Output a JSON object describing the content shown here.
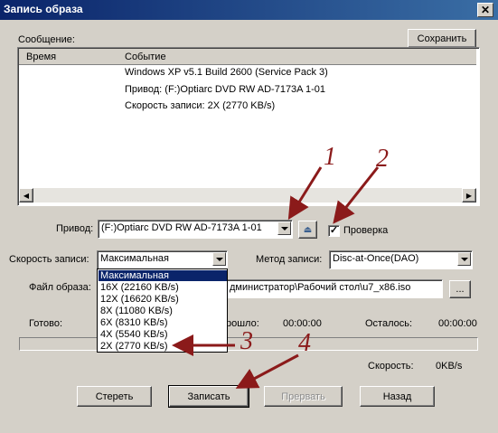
{
  "window": {
    "title": "Запись образа",
    "close_glyph": "✕"
  },
  "message": {
    "label": "Сообщение:",
    "save_button": "Сохранить"
  },
  "log": {
    "col_time": "Время",
    "col_event": "Событие",
    "rows": [
      {
        "event": "Windows XP v5.1 Build 2600 (Service Pack 3)"
      },
      {
        "event": "Привод: (F:)Optiarc DVD RW AD-7173A 1-01"
      },
      {
        "event": "Скорость записи: 2X (2770 KB/s)"
      }
    ]
  },
  "drive": {
    "label": "Привод:",
    "value": "(F:)Optiarc DVD RW AD-7173A 1-01"
  },
  "verify": {
    "label": "Проверка",
    "checked": true
  },
  "speed": {
    "label": "Скорость записи:",
    "value": "Максимальная",
    "options": [
      "Максимальная",
      "16X (22160 KB/s)",
      "12X (16620 KB/s)",
      "8X (11080 KB/s)",
      "6X (8310 KB/s)",
      "4X (5540 KB/s)",
      "2X (2770 KB/s)"
    ]
  },
  "method": {
    "label": "Метод записи:",
    "value": "Disc-at-Once(DAO)"
  },
  "image_file": {
    "label": "Файл образа:",
    "value": "дминистратор\\Рабочий стол\\u7_x86.iso",
    "browse": "..."
  },
  "status": {
    "ready_label": "Готово:",
    "elapsed_label": "рошло:",
    "elapsed_value": "00:00:00",
    "remaining_label": "Осталось:",
    "remaining_value": "00:00:00",
    "progress": 0,
    "speed_label": "Скорость:",
    "speed_value": "0KB/s"
  },
  "buttons": {
    "erase": "Стереть",
    "write": "Записать",
    "abort": "Прервать",
    "back": "Назад"
  },
  "annotations": {
    "n1": "1",
    "n2": "2",
    "n3": "3",
    "n4": "4",
    "color": "#8b1a1a"
  }
}
